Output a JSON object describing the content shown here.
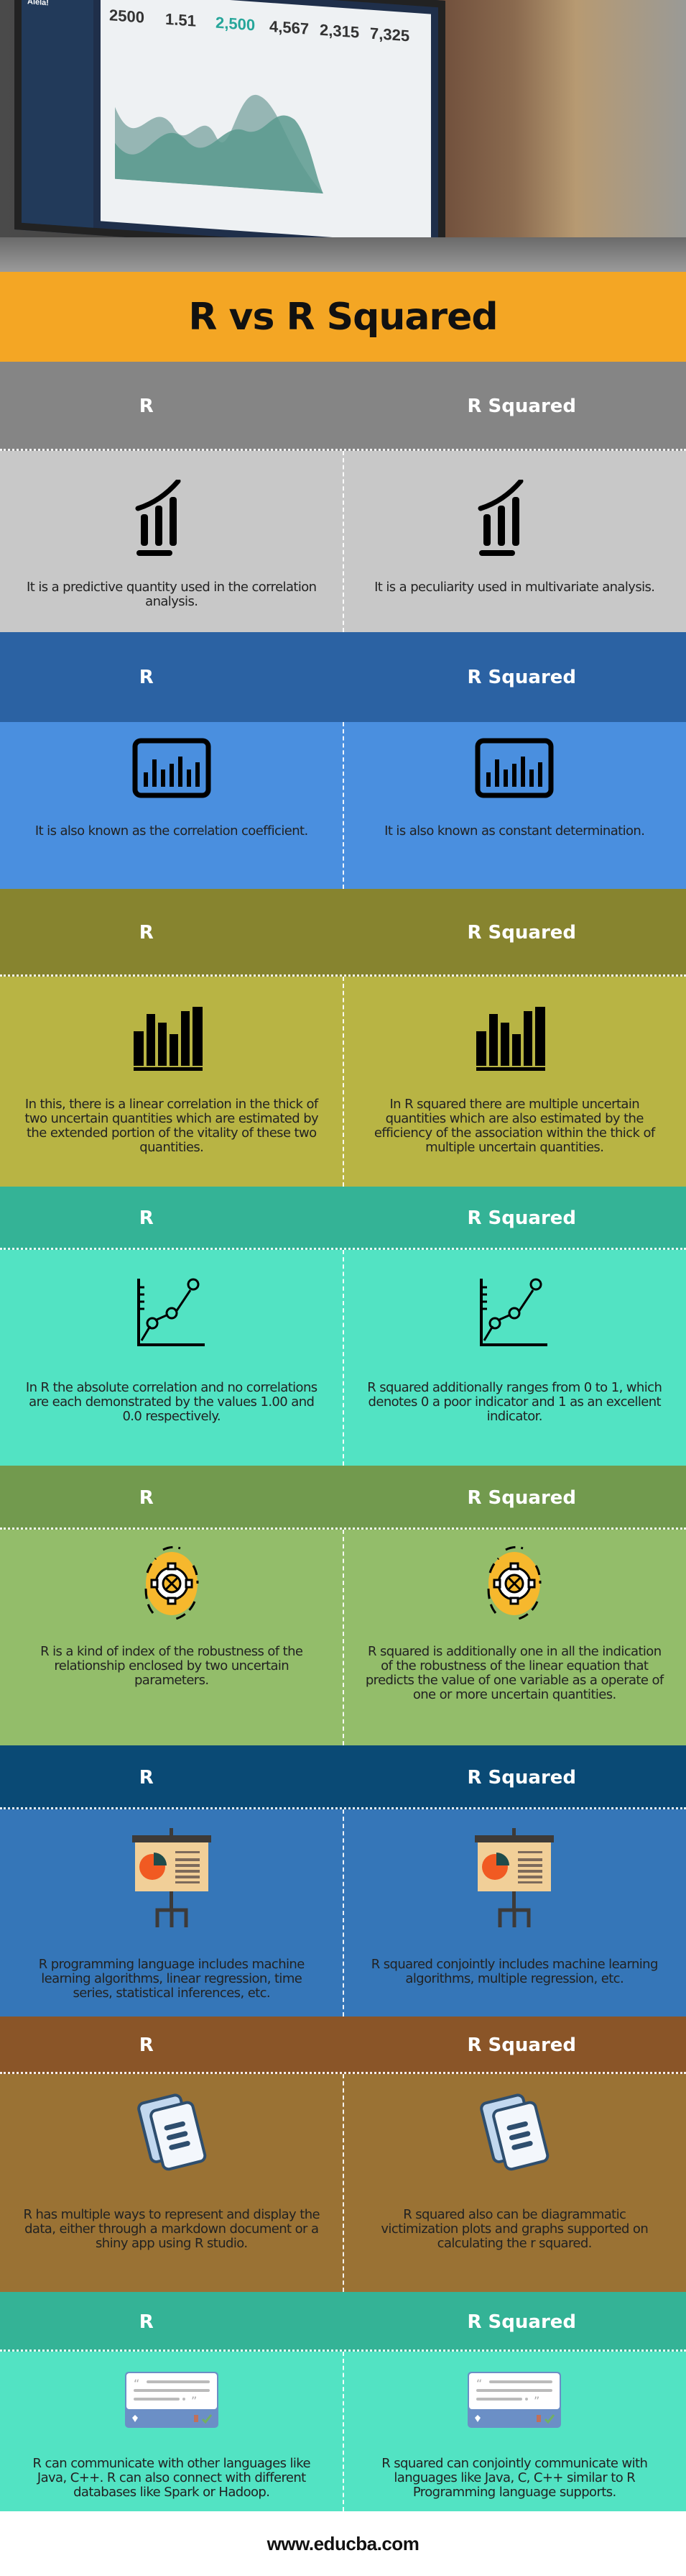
{
  "title": "R vs R Squared",
  "hero": {
    "dashboard_brand": "Gentelella Alela!",
    "stats": [
      "2500",
      "1.51",
      "2,500",
      "4,567",
      "2,315",
      "7,325"
    ]
  },
  "columns": {
    "left": "R",
    "right": "R Squared"
  },
  "sections": [
    {
      "icon": "growth-bar-chart-icon",
      "colors": {
        "header": "#858585",
        "body": "#c8c8c8"
      },
      "left": "It is a predictive quantity used in the correlation analysis.",
      "right": "It is a peculiarity used in multivariate analysis."
    },
    {
      "icon": "monitor-bar-chart-icon",
      "colors": {
        "header": "#2b62a3",
        "body": "#4a8fdf"
      },
      "left": "It is also known as the correlation coefficient.",
      "right": "It is also known as constant determination."
    },
    {
      "icon": "bar-chart-icon",
      "colors": {
        "header": "#87842f",
        "body": "#b8b444"
      },
      "left": "In this, there is a linear correlation in the thick of two uncertain quantities which are estimated by the extended portion of the vitality of these two quantities.",
      "right": "In R squared there are multiple uncertain quantities which are also estimated by the efficiency of the association within the thick of multiple uncertain quantities."
    },
    {
      "icon": "line-chart-icon",
      "colors": {
        "header": "#34b396",
        "body": "#52e3c3"
      },
      "left": "In R the absolute correlation and no correlations are each demonstrated by the values 1.00 and 0.0 respectively.",
      "right": "R squared additionally ranges from 0 to 1, which denotes 0 a poor indicator and 1 as an excellent indicator."
    },
    {
      "icon": "gear-icon",
      "colors": {
        "header": "#729a4e",
        "body": "#93bd6a"
      },
      "left": "R is a kind of index of the robustness of the relationship enclosed by two uncertain parameters.",
      "right": "R squared is additionally one in all the indication of the robustness of the linear equation that predicts the value of one variable as a operate of one or more uncertain quantities."
    },
    {
      "icon": "presentation-board-icon",
      "colors": {
        "header": "#0a4a75",
        "body": "#3576b8"
      },
      "left": "R programming language includes machine learning algorithms, linear regression, time series, statistical inferences, etc.",
      "right": "R squared conjointly includes machine learning algorithms, multiple regression, etc."
    },
    {
      "icon": "documents-icon",
      "colors": {
        "header": "#8a5528",
        "body": "#9a7234"
      },
      "left": "R has multiple ways to represent and display the data, either through a markdown document or a shiny app using R studio.",
      "right": "R squared also can be diagrammatic victimization plots and graphs supported on calculating the r squared."
    },
    {
      "icon": "quote-card-icon",
      "colors": {
        "header": "#34b396",
        "body": "#52e3c3"
      },
      "left": "R can communicate with other languages like Java, C++. R can also connect with different databases like Spark or Hadoop.",
      "right": "R squared can conjointly communicate with languages like Java, C, C++ similar to R Programming language supports."
    }
  ],
  "footer": {
    "url": "www.educba.com"
  }
}
